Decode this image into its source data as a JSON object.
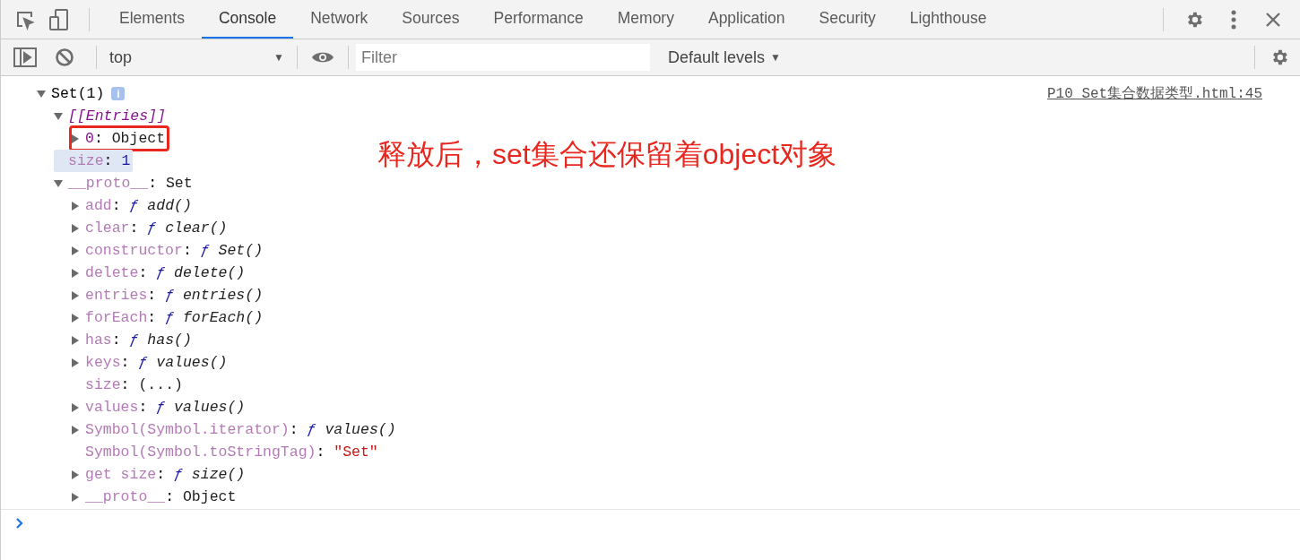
{
  "toolbar": {
    "tabs": [
      {
        "label": "Elements",
        "selected": false
      },
      {
        "label": "Console",
        "selected": true
      },
      {
        "label": "Network",
        "selected": false
      },
      {
        "label": "Sources",
        "selected": false
      },
      {
        "label": "Performance",
        "selected": false
      },
      {
        "label": "Memory",
        "selected": false
      },
      {
        "label": "Application",
        "selected": false
      },
      {
        "label": "Security",
        "selected": false
      },
      {
        "label": "Lighthouse",
        "selected": false
      }
    ]
  },
  "console_bar": {
    "context": {
      "label": "top",
      "arrow": "▼"
    },
    "filter": {
      "placeholder": "Filter"
    },
    "levels": {
      "label": "Default levels",
      "arrow": "▼"
    }
  },
  "log": {
    "source": "P10_Set集合数据类型.html:45",
    "tree": [
      {
        "kind": "node",
        "label": "Set(1)",
        "badge": "i",
        "expanded": true,
        "children": [
          {
            "kind": "node",
            "key": "[[Entries]]",
            "key_italic": true,
            "key_dim": false,
            "expanded": true,
            "children": [
              {
                "kind": "node",
                "key": "0",
                "key_dim": false,
                "sep": ":",
                "value": "Object",
                "expanded": false,
                "annotated": true
              }
            ]
          },
          {
            "kind": "leaf",
            "key": "size",
            "key_dim": true,
            "sep": ":",
            "value": "1",
            "numeric": true,
            "highlighted": true
          },
          {
            "kind": "node",
            "key": "__proto__",
            "key_dim": true,
            "sep": ":",
            "value": "Set",
            "expanded": true,
            "children": [
              {
                "kind": "node",
                "key": "add",
                "key_dim": true,
                "sep": ":",
                "sign": "ƒ",
                "value": "add()",
                "value_italic": true,
                "expanded": false
              },
              {
                "kind": "node",
                "key": "clear",
                "key_dim": true,
                "sep": ":",
                "sign": "ƒ",
                "value": "clear()",
                "value_italic": true,
                "expanded": false
              },
              {
                "kind": "node",
                "key": "constructor",
                "key_dim": true,
                "sep": ":",
                "sign": "ƒ",
                "value": "Set()",
                "value_italic": true,
                "expanded": false
              },
              {
                "kind": "node",
                "key": "delete",
                "key_dim": true,
                "sep": ":",
                "sign": "ƒ",
                "value": "delete()",
                "value_italic": true,
                "expanded": false
              },
              {
                "kind": "node",
                "key": "entries",
                "key_dim": true,
                "sep": ":",
                "sign": "ƒ",
                "value": "entries()",
                "value_italic": true,
                "expanded": false
              },
              {
                "kind": "node",
                "key": "forEach",
                "key_dim": true,
                "sep": ":",
                "sign": "ƒ",
                "value": "forEach()",
                "value_italic": true,
                "expanded": false
              },
              {
                "kind": "node",
                "key": "has",
                "key_dim": true,
                "sep": ":",
                "sign": "ƒ",
                "value": "has()",
                "value_italic": true,
                "expanded": false
              },
              {
                "kind": "node",
                "key": "keys",
                "key_dim": true,
                "sep": ":",
                "sign": "ƒ",
                "value": "values()",
                "value_italic": true,
                "expanded": false
              },
              {
                "kind": "leaf",
                "key": "size",
                "key_dim": true,
                "sep": ":",
                "value": "(...)"
              },
              {
                "kind": "node",
                "key": "values",
                "key_dim": true,
                "sep": ":",
                "sign": "ƒ",
                "value": "values()",
                "value_italic": true,
                "expanded": false
              },
              {
                "kind": "node",
                "key": "Symbol(Symbol.iterator)",
                "key_dim": true,
                "sep": ":",
                "sign": "ƒ",
                "value": "values()",
                "value_italic": true,
                "expanded": false
              },
              {
                "kind": "leaf",
                "key": "Symbol(Symbol.toStringTag)",
                "key_dim": true,
                "sep": ":",
                "value": "\"Set\"",
                "quoted": true
              },
              {
                "kind": "node",
                "key": "get size",
                "key_dim": true,
                "sep": ":",
                "sign": "ƒ",
                "value": "size()",
                "value_italic": true,
                "expanded": false
              },
              {
                "kind": "node",
                "key": "__proto__",
                "key_dim": true,
                "sep": ":",
                "value": "Object",
                "expanded": false
              }
            ]
          }
        ]
      }
    ]
  },
  "annotation": "释放后，set集合还保留着object对象"
}
